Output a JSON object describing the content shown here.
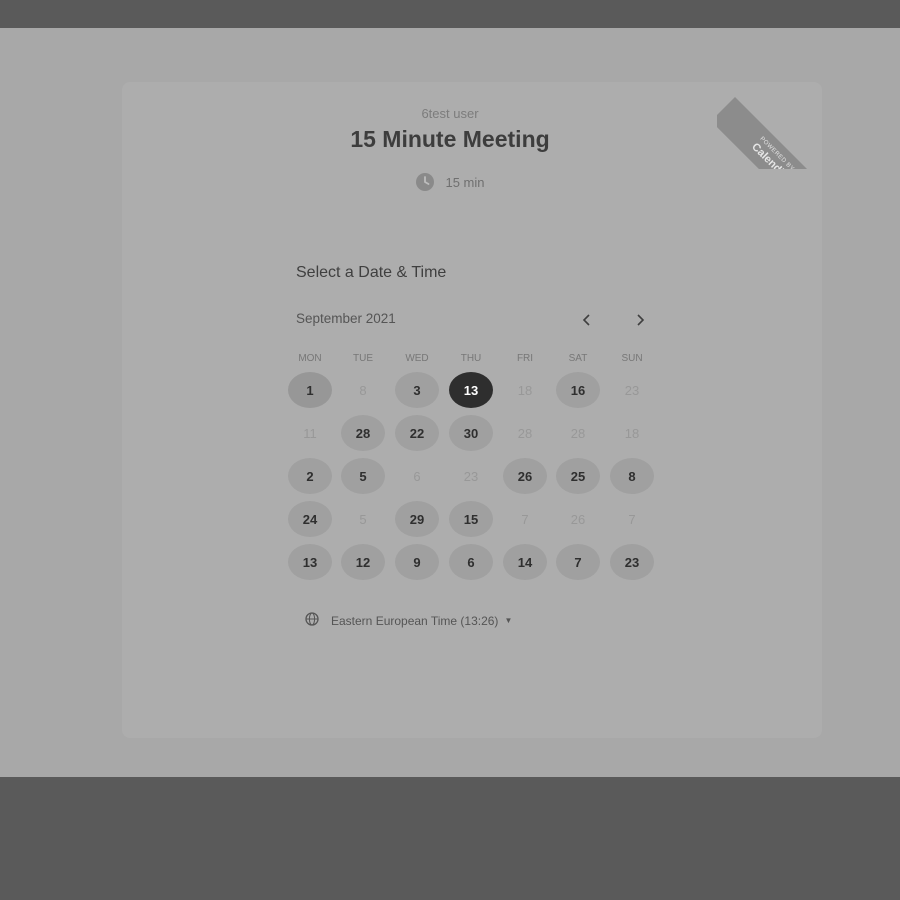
{
  "event": {
    "host_name": "6test user",
    "title": "15 Minute Meeting",
    "duration": "15 min"
  },
  "branding": {
    "powered_by": "POWERED BY",
    "brand": "Calendly"
  },
  "scheduler": {
    "heading": "Select a Date & Time",
    "month_label": "September 2021",
    "weekdays": [
      "MON",
      "TUE",
      "WED",
      "THU",
      "FRI",
      "SAT",
      "SUN"
    ],
    "weeks": [
      [
        {
          "label": "1",
          "state": "today"
        },
        {
          "label": "8",
          "state": "unavailable"
        },
        {
          "label": "3",
          "state": "available"
        },
        {
          "label": "13",
          "state": "selected"
        },
        {
          "label": "18",
          "state": "unavailable"
        },
        {
          "label": "16",
          "state": "available"
        },
        {
          "label": "23",
          "state": "unavailable"
        }
      ],
      [
        {
          "label": "11",
          "state": "unavailable"
        },
        {
          "label": "28",
          "state": "available"
        },
        {
          "label": "22",
          "state": "available"
        },
        {
          "label": "30",
          "state": "available"
        },
        {
          "label": "28",
          "state": "unavailable"
        },
        {
          "label": "28",
          "state": "unavailable"
        },
        {
          "label": "18",
          "state": "unavailable"
        }
      ],
      [
        {
          "label": "2",
          "state": "available"
        },
        {
          "label": "5",
          "state": "available"
        },
        {
          "label": "6",
          "state": "unavailable"
        },
        {
          "label": "23",
          "state": "unavailable"
        },
        {
          "label": "26",
          "state": "available"
        },
        {
          "label": "25",
          "state": "available"
        },
        {
          "label": "8",
          "state": "available"
        }
      ],
      [
        {
          "label": "24",
          "state": "available"
        },
        {
          "label": "5",
          "state": "unavailable"
        },
        {
          "label": "29",
          "state": "available"
        },
        {
          "label": "15",
          "state": "available"
        },
        {
          "label": "7",
          "state": "unavailable"
        },
        {
          "label": "26",
          "state": "unavailable"
        },
        {
          "label": "7",
          "state": "unavailable"
        }
      ],
      [
        {
          "label": "13",
          "state": "available"
        },
        {
          "label": "12",
          "state": "available"
        },
        {
          "label": "9",
          "state": "available"
        },
        {
          "label": "6",
          "state": "available"
        },
        {
          "label": "14",
          "state": "available"
        },
        {
          "label": "7",
          "state": "available"
        },
        {
          "label": "23",
          "state": "available"
        }
      ]
    ],
    "timezone": "Eastern European Time (13:26)"
  },
  "icons": {
    "clock": "clock-icon",
    "globe": "globe-icon",
    "prev": "chevron-left-icon",
    "next": "chevron-right-icon",
    "caret": "caret-down-icon"
  },
  "colors": {
    "selected_day": "#2e2e2e",
    "available_day": "#a0a0a0",
    "ribbon": "#8c8c8c"
  }
}
